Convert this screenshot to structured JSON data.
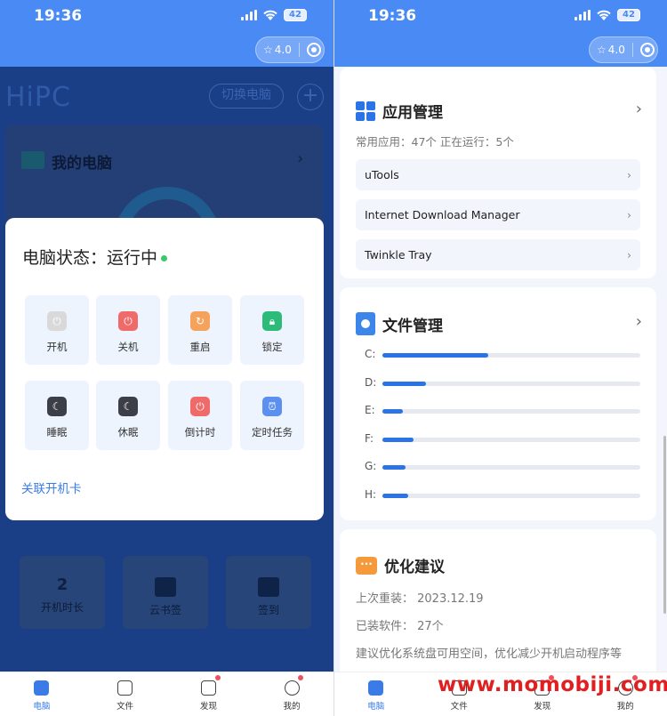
{
  "status": {
    "time": "19:36",
    "battery": "42"
  },
  "capsule": {
    "rating": "4.0"
  },
  "left": {
    "app_logo": "HiPC",
    "switch_label": "切换电脑",
    "pc_card_title": "我的电脑",
    "grid": [
      {
        "value": "2",
        "label": "开机时长"
      },
      {
        "label": "云书签"
      },
      {
        "label": "签到"
      }
    ],
    "modal": {
      "title": "电脑状态：运行中",
      "actions": [
        {
          "label": "开机",
          "icon": "power-on-icon",
          "color": "#d9d9d9"
        },
        {
          "label": "关机",
          "icon": "power-off-icon",
          "color": "#f06a6a"
        },
        {
          "label": "重启",
          "icon": "restart-icon",
          "color": "#f5a35c"
        },
        {
          "label": "锁定",
          "icon": "lock-icon",
          "color": "#2dbb7a"
        },
        {
          "label": "睡眠",
          "icon": "moon-icon",
          "color": "#3c3f47"
        },
        {
          "label": "休眠",
          "icon": "hibernate-icon",
          "color": "#3c3f47"
        },
        {
          "label": "倒计时",
          "icon": "countdown-icon",
          "color": "#f06a6a"
        },
        {
          "label": "定时任务",
          "icon": "alarm-icon",
          "color": "#5b8ff0"
        }
      ],
      "link": "关联开机卡"
    }
  },
  "right": {
    "app_mgmt": {
      "title": "应用管理",
      "stats": "常用应用：47个   正在运行：5个",
      "apps": [
        "uTools",
        "Internet Download Manager",
        "Twinkle Tray"
      ]
    },
    "file_mgmt": {
      "title": "文件管理",
      "drives": [
        {
          "label": "C:",
          "used": 0.41
        },
        {
          "label": "D:",
          "used": 0.17
        },
        {
          "label": "E:",
          "used": 0.08
        },
        {
          "label": "F:",
          "used": 0.12
        },
        {
          "label": "G:",
          "used": 0.09
        },
        {
          "label": "H:",
          "used": 0.1
        }
      ]
    },
    "optimize": {
      "title": "优化建议",
      "last_reinstall": "上次重装：  2023.12.19",
      "installed": "已装软件：  27个",
      "tip": "建议优化系统盘可用空间，优化减少开机启动程序等"
    }
  },
  "tabs": [
    {
      "label": "电脑"
    },
    {
      "label": "文件"
    },
    {
      "label": "发现"
    },
    {
      "label": "我的"
    }
  ],
  "watermark": "www.momobiji.com",
  "colors": {
    "primary": "#4a8af4",
    "link": "#3a7be8",
    "progress": "#2a74e8"
  }
}
